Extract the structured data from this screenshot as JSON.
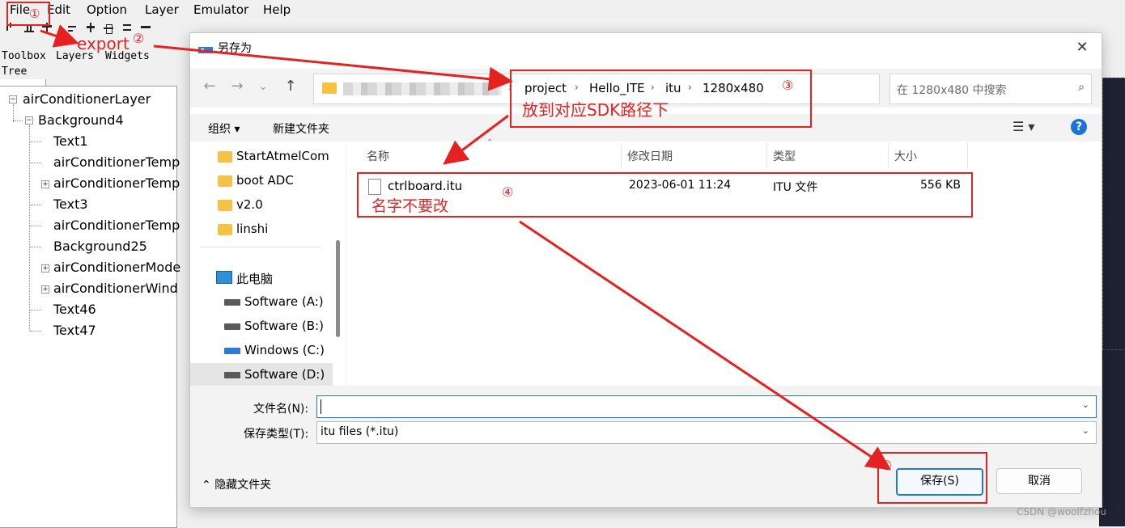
{
  "app": {
    "menu": [
      "File",
      "Edit",
      "Option",
      "Layer",
      "Emulator",
      "Help"
    ],
    "panel_tabs": [
      "Toolbox",
      "Layers",
      "Widgets",
      "Tree"
    ],
    "tree": {
      "root": "airConditionerLayer",
      "child": "Background4",
      "leaves": [
        "Text1",
        "airConditionerTemp",
        "airConditionerTemp",
        "Text3",
        "airConditionerTemp",
        "Background25",
        "airConditionerMode",
        "airConditionerWind",
        "Text46",
        "Text47"
      ]
    }
  },
  "dialog": {
    "title": "另存为",
    "close_glyph": "✕",
    "nav": {
      "back": "←",
      "forward": "→",
      "recent": "⌄",
      "up": "↑"
    },
    "breadcrumb": [
      "project",
      "Hello_ITE",
      "itu",
      "1280x480"
    ],
    "breadcrumb_sep": "›",
    "search_placeholder": "在 1280x480 中搜索",
    "toolbar": {
      "organize": "组织 ▾",
      "new_folder": "新建文件夹"
    },
    "sidebar": {
      "folders": [
        "StartAtmelCom",
        "boot ADC",
        "v2.0",
        "linshi"
      ],
      "this_pc": "此电脑",
      "drives": [
        "Software (A:)",
        "Software (B:)",
        "Windows (C:)",
        "Software (D:)"
      ]
    },
    "columns": [
      "名称",
      "修改日期",
      "类型",
      "大小"
    ],
    "files": [
      {
        "name": "ctrlboard.itu",
        "modified": "2023-06-01 11:24",
        "type": "ITU 文件",
        "size": "556 KB"
      }
    ],
    "filename_label": "文件名(N):",
    "filename_value": "",
    "filetype_label": "保存类型(T):",
    "filetype_value": "itu files (*.itu)",
    "hide_folders": "隐藏文件夹",
    "save": "保存(S)",
    "cancel": "取消"
  },
  "annotations": {
    "n1": "①",
    "n2": "②",
    "export": "export",
    "n3": "③",
    "path_note": "放到对应SDK路径下",
    "n4": "④",
    "name_note": "名字不要改",
    "n5": "⑤",
    "color": "#e52222"
  },
  "watermark": "CSDN @woolfzhou"
}
